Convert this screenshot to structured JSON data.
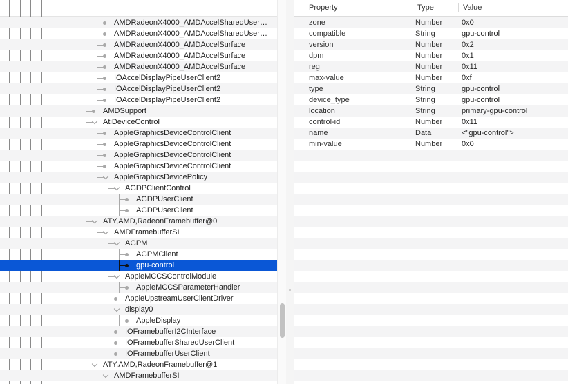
{
  "tree": {
    "rows": [
      {
        "label": "AMDRadeonX4000_AMDAccelSharedUser…",
        "depth": 2,
        "kind": "leaf"
      },
      {
        "label": "AMDRadeonX4000_AMDAccelSharedUser…",
        "depth": 2,
        "kind": "leaf"
      },
      {
        "label": "AMDRadeonX4000_AMDAccelSurface",
        "depth": 2,
        "kind": "leaf"
      },
      {
        "label": "AMDRadeonX4000_AMDAccelSurface",
        "depth": 2,
        "kind": "leaf"
      },
      {
        "label": "AMDRadeonX4000_AMDAccelSurface",
        "depth": 2,
        "kind": "leaf"
      },
      {
        "label": "IOAccelDisplayPipeUserClient2",
        "depth": 2,
        "kind": "leaf"
      },
      {
        "label": "IOAccelDisplayPipeUserClient2",
        "depth": 2,
        "kind": "leaf"
      },
      {
        "label": "IOAccelDisplayPipeUserClient2",
        "depth": 2,
        "kind": "leaf"
      },
      {
        "label": "AMDSupport",
        "depth": 1,
        "kind": "leaf"
      },
      {
        "label": "AtiDeviceControl",
        "depth": 1,
        "kind": "expanded"
      },
      {
        "label": "AppleGraphicsDeviceControlClient",
        "depth": 2,
        "kind": "leaf"
      },
      {
        "label": "AppleGraphicsDeviceControlClient",
        "depth": 2,
        "kind": "leaf"
      },
      {
        "label": "AppleGraphicsDeviceControlClient",
        "depth": 2,
        "kind": "leaf"
      },
      {
        "label": "AppleGraphicsDeviceControlClient",
        "depth": 2,
        "kind": "leaf"
      },
      {
        "label": "AppleGraphicsDevicePolicy",
        "depth": 2,
        "kind": "expanded"
      },
      {
        "label": "AGDPClientControl",
        "depth": 3,
        "kind": "expanded"
      },
      {
        "label": "AGDPUserClient",
        "depth": 4,
        "kind": "leaf"
      },
      {
        "label": "AGDPUserClient",
        "depth": 4,
        "kind": "leaf"
      },
      {
        "label": "ATY,AMD,RadeonFramebuffer@0",
        "depth": 1,
        "kind": "expanded"
      },
      {
        "label": "AMDFramebufferSI",
        "depth": 2,
        "kind": "expanded"
      },
      {
        "label": "AGPM",
        "depth": 3,
        "kind": "expanded"
      },
      {
        "label": "AGPMClient",
        "depth": 4,
        "kind": "leaf"
      },
      {
        "label": "gpu-control",
        "depth": 4,
        "kind": "leaf",
        "selected": true
      },
      {
        "label": "AppleMCCSControlModule",
        "depth": 3,
        "kind": "expanded"
      },
      {
        "label": "AppleMCCSParameterHandler",
        "depth": 4,
        "kind": "leaf"
      },
      {
        "label": "AppleUpstreamUserClientDriver",
        "depth": 3,
        "kind": "leaf"
      },
      {
        "label": "display0",
        "depth": 3,
        "kind": "expanded"
      },
      {
        "label": "AppleDisplay",
        "depth": 4,
        "kind": "leaf"
      },
      {
        "label": "IOFramebufferI2CInterface",
        "depth": 3,
        "kind": "leaf"
      },
      {
        "label": "IOFramebufferSharedUserClient",
        "depth": 3,
        "kind": "leaf"
      },
      {
        "label": "IOFramebufferUserClient",
        "depth": 3,
        "kind": "leaf"
      },
      {
        "label": "ATY,AMD,RadeonFramebuffer@1",
        "depth": 1,
        "kind": "expanded"
      },
      {
        "label": "AMDFramebufferSI",
        "depth": 2,
        "kind": "expanded"
      }
    ]
  },
  "properties": {
    "columns": {
      "property": "Property",
      "type": "Type",
      "value": "Value"
    },
    "rows": [
      {
        "property": "zone",
        "type": "Number",
        "value": "0x0"
      },
      {
        "property": "compatible",
        "type": "String",
        "value": "gpu-control"
      },
      {
        "property": "version",
        "type": "Number",
        "value": "0x2"
      },
      {
        "property": "dpm",
        "type": "Number",
        "value": "0x1"
      },
      {
        "property": "reg",
        "type": "Number",
        "value": "0x11"
      },
      {
        "property": "max-value",
        "type": "Number",
        "value": "0xf"
      },
      {
        "property": "type",
        "type": "String",
        "value": "gpu-control"
      },
      {
        "property": "device_type",
        "type": "String",
        "value": "gpu-control"
      },
      {
        "property": "location",
        "type": "String",
        "value": "primary-gpu-control"
      },
      {
        "property": "control-id",
        "type": "Number",
        "value": "0x11"
      },
      {
        "property": "name",
        "type": "Data",
        "value": "<\"gpu-control\">"
      },
      {
        "property": "min-value",
        "type": "Number",
        "value": "0x0"
      }
    ]
  },
  "colors": {
    "selection": "#0a57d6",
    "stripe": "#f4f4f5"
  }
}
